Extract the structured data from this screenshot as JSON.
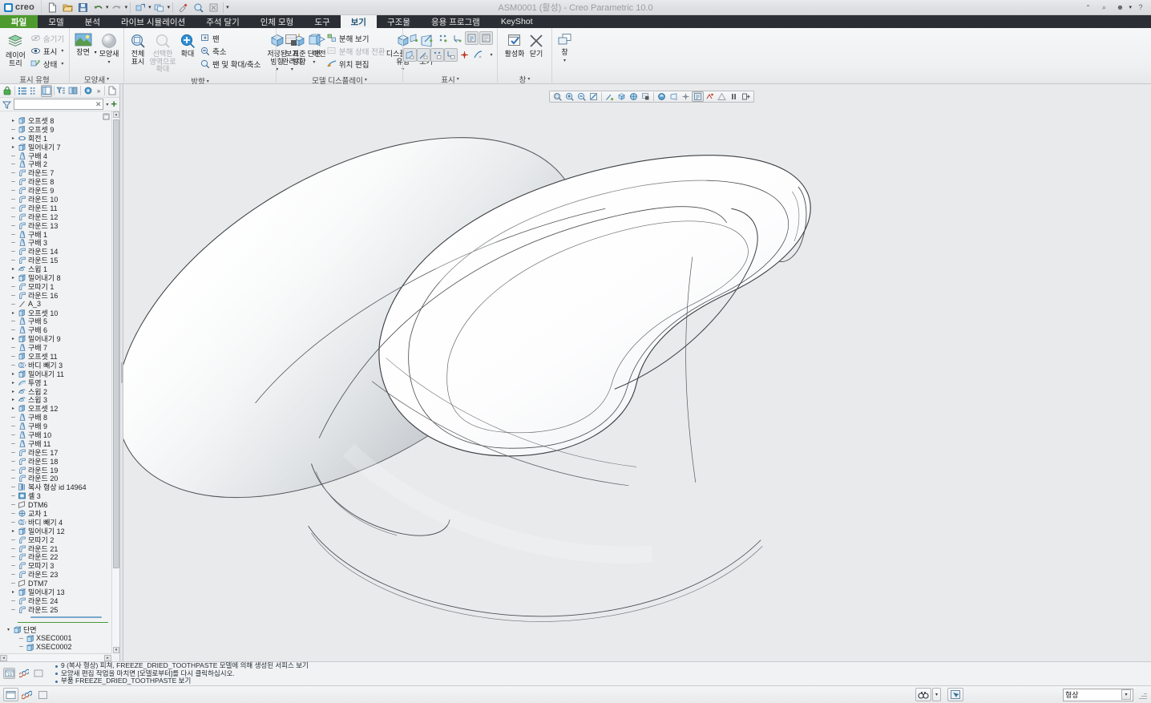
{
  "window": {
    "title": "ASM0001 (활성) - Creo Parametric 10.0",
    "brand": "creo",
    "controls": [
      {
        "name": "collapse-ribbon-button",
        "glyph": "⌃"
      },
      {
        "name": "search-button",
        "glyph": "⌕"
      },
      {
        "name": "account-button",
        "glyph": "☻"
      },
      {
        "name": "account-caret",
        "glyph": "▾"
      },
      {
        "name": "help-button",
        "glyph": "?"
      }
    ]
  },
  "quick_access": [
    {
      "name": "new-button",
      "icon": "new-file-icon"
    },
    {
      "name": "open-button",
      "icon": "open-folder-icon"
    },
    {
      "name": "save-button",
      "icon": "save-disk-icon"
    },
    {
      "name": "undo-button",
      "icon": "undo-arrow-icon"
    },
    {
      "name": "undo-caret",
      "icon": "chevron-down-icon"
    },
    {
      "name": "redo-button",
      "icon": "redo-arrow-icon"
    },
    {
      "name": "redo-caret",
      "icon": "chevron-down-icon"
    },
    {
      "name": "regenerate-button",
      "icon": "regenerate-icon"
    },
    {
      "name": "regenerate-caret",
      "icon": "chevron-down-icon"
    },
    {
      "name": "window-button",
      "icon": "window-switch-icon"
    },
    {
      "name": "window-caret",
      "icon": "chevron-down-icon"
    },
    {
      "name": "paint-button",
      "icon": "paintbrush-icon"
    },
    {
      "name": "magnifier-button",
      "icon": "magnifier-icon"
    },
    {
      "name": "close-window-button",
      "icon": "close-x-icon"
    },
    {
      "name": "qat-overflow",
      "icon": "chevron-down-icon"
    }
  ],
  "ribbon": {
    "tabs": [
      {
        "label": "파일",
        "kind": "file"
      },
      {
        "label": "모델",
        "kind": "normal"
      },
      {
        "label": "분석",
        "kind": "normal"
      },
      {
        "label": "라이브 시뮬레이션",
        "kind": "normal"
      },
      {
        "label": "주석 달기",
        "kind": "normal"
      },
      {
        "label": "인체 모형",
        "kind": "normal"
      },
      {
        "label": "도구",
        "kind": "normal"
      },
      {
        "label": "보기",
        "kind": "active"
      },
      {
        "label": "구조물",
        "kind": "normal"
      },
      {
        "label": "응용 프로그램",
        "kind": "normal"
      },
      {
        "label": "KeyShot",
        "kind": "normal"
      }
    ],
    "groups": [
      {
        "name": "visibility",
        "label": "표시 유형",
        "big": [
          {
            "label": "레이어 트리",
            "icon": "layers-icon"
          }
        ],
        "small": [
          {
            "label": "숨기기",
            "icon": "hide-eye-icon",
            "dim": true,
            "caret": false
          },
          {
            "label": "표시",
            "icon": "eye-icon",
            "dim": false,
            "caret": true
          },
          {
            "label": "상태",
            "icon": "state-icon",
            "dim": false,
            "caret": true
          }
        ]
      },
      {
        "name": "appearance",
        "label": "모양새",
        "caret": true,
        "big": [
          {
            "label": "장면",
            "icon": "scene-image-icon",
            "caret": true
          },
          {
            "label": "모양새",
            "icon": "appearance-sphere-icon",
            "caret": true
          }
        ]
      },
      {
        "name": "orientation",
        "label": "방향",
        "caret": true,
        "big": [
          {
            "label": "전체 표시",
            "icon": "zoom-fit-icon"
          },
          {
            "label": "선택한 영역으로 확대",
            "icon": "zoom-area-icon",
            "dim": true
          },
          {
            "label": "확대",
            "icon": "zoom-in-plus-icon"
          }
        ],
        "small": [
          {
            "label": "팬",
            "icon": "pan-icon"
          },
          {
            "label": "축소",
            "icon": "zoom-out-icon"
          },
          {
            "label": "팬 및 확대/축소",
            "icon": "pan-zoom-icon"
          }
        ],
        "big2": [
          {
            "label": "저장된 방향",
            "icon": "saved-orientation-icon",
            "caret": true
          },
          {
            "label": "표준 방향",
            "icon": "standard-orientation-icon"
          },
          {
            "label": "이전",
            "icon": "previous-view-icon"
          }
        ]
      },
      {
        "name": "model-display",
        "label": "모델 디스플레이",
        "caret": true,
        "big": [
          {
            "label": "보기 관리자",
            "icon": "view-manager-icon",
            "caret": true
          },
          {
            "label": "단면",
            "icon": "cross-section-icon",
            "caret": true
          }
        ],
        "small": [
          {
            "label": "분해 보기",
            "icon": "explode-view-icon"
          },
          {
            "label": "분해 상태 전환",
            "icon": "explode-toggle-icon",
            "dim": true
          },
          {
            "label": "위치 편집",
            "icon": "edit-position-icon"
          }
        ],
        "big2": [
          {
            "label": "디스플레이 유형",
            "icon": "display-style-cube-icon",
            "caret": true
          },
          {
            "label": "원근 보기",
            "icon": "perspective-view-icon"
          }
        ]
      },
      {
        "name": "display",
        "label": "표시",
        "caret": true,
        "toggles_top": [
          {
            "name": "datum-plane-toggle",
            "icon": "datum-plane-icon"
          },
          {
            "name": "datum-axis-toggle",
            "icon": "datum-axis-icon"
          },
          {
            "name": "datum-point-toggle",
            "icon": "datum-point-icon"
          },
          {
            "name": "datum-csys-toggle",
            "icon": "datum-csys-icon"
          },
          {
            "name": "annotation-toggle",
            "icon": "annotation-display-icon",
            "pressed": true
          },
          {
            "name": "annotation-tag-toggle",
            "icon": "annotation-tag-icon",
            "pressed": true
          }
        ],
        "toggles_bottom": [
          {
            "name": "plane-tag-toggle",
            "icon": "plane-tag-icon",
            "pressed": true
          },
          {
            "name": "axis-tag-toggle",
            "icon": "axis-tag-icon",
            "pressed": true
          },
          {
            "name": "point-tag-toggle",
            "icon": "point-tag-icon",
            "pressed": true
          },
          {
            "name": "csys-tag-toggle",
            "icon": "csys-tag-icon",
            "pressed": true
          },
          {
            "name": "spin-center-toggle",
            "icon": "spin-center-icon"
          },
          {
            "name": "curve-display-toggle",
            "icon": "curve-display-icon"
          },
          {
            "name": "display-overflow-caret",
            "icon": "chevron-down-icon"
          }
        ]
      },
      {
        "name": "window",
        "label": "창",
        "caret": true,
        "big": [
          {
            "label": "활성화",
            "icon": "activate-check-icon"
          },
          {
            "label": "닫기",
            "icon": "close-x-icon"
          }
        ],
        "big2": [
          {
            "label": "창",
            "icon": "windows-cascade-icon",
            "caret": true
          }
        ]
      }
    ]
  },
  "navigator": {
    "toolbar": [
      {
        "name": "model-tree-lock-button",
        "icon": "green-lock-icon"
      },
      {
        "name": "tree-list-button",
        "icon": "list-icon"
      },
      {
        "name": "tree-columns-button",
        "icon": "columns-icon"
      },
      {
        "name": "tree-layout-button",
        "icon": "layout-icon",
        "pressed": true
      },
      {
        "name": "tree-filter-button",
        "icon": "filter-sort-icon"
      },
      {
        "name": "tree-search-button",
        "icon": "tree-search-icon"
      },
      {
        "name": "tree-settings-button",
        "icon": "settings-blob-icon"
      },
      {
        "name": "tree-overflow-button",
        "icon": "double-chevron-icon"
      },
      {
        "name": "tree-document-button",
        "icon": "document-icon"
      }
    ],
    "filter": {
      "value": "",
      "placeholder": "",
      "clear_glyph": "✕",
      "caret_glyph": "▾",
      "add_glyph": "+"
    },
    "tree_items": [
      {
        "label": "오프셋 8",
        "icon": "offset-icon",
        "expandable": true,
        "indent": 0
      },
      {
        "label": "오프셋 9",
        "icon": "offset-icon",
        "expandable": false,
        "indent": 0
      },
      {
        "label": "회전 1",
        "icon": "revolve-icon",
        "expandable": true,
        "indent": 0
      },
      {
        "label": "밀어내기 7",
        "icon": "extrude-icon",
        "expandable": true,
        "indent": 0
      },
      {
        "label": "구배 4",
        "icon": "draft-icon",
        "expandable": false,
        "indent": 0
      },
      {
        "label": "구배 2",
        "icon": "draft-icon",
        "expandable": false,
        "indent": 0
      },
      {
        "label": "라운드 7",
        "icon": "round-icon",
        "expandable": false,
        "indent": 0
      },
      {
        "label": "라운드 8",
        "icon": "round-icon",
        "expandable": false,
        "indent": 0
      },
      {
        "label": "라운드 9",
        "icon": "round-icon",
        "expandable": false,
        "indent": 0
      },
      {
        "label": "라운드 10",
        "icon": "round-icon",
        "expandable": false,
        "indent": 0
      },
      {
        "label": "라운드 11",
        "icon": "round-icon",
        "expandable": false,
        "indent": 0
      },
      {
        "label": "라운드 12",
        "icon": "round-icon",
        "expandable": false,
        "indent": 0
      },
      {
        "label": "라운드 13",
        "icon": "round-icon",
        "expandable": false,
        "indent": 0
      },
      {
        "label": "구배 1",
        "icon": "draft-icon",
        "expandable": false,
        "indent": 0
      },
      {
        "label": "구배 3",
        "icon": "draft-icon",
        "expandable": false,
        "indent": 0
      },
      {
        "label": "라운드 14",
        "icon": "round-icon",
        "expandable": false,
        "indent": 0
      },
      {
        "label": "라운드 15",
        "icon": "round-icon",
        "expandable": false,
        "indent": 0
      },
      {
        "label": "스윕 1",
        "icon": "sweep-icon",
        "expandable": true,
        "indent": 0
      },
      {
        "label": "밀어내기 8",
        "icon": "extrude-icon",
        "expandable": true,
        "indent": 0
      },
      {
        "label": "모따기 1",
        "icon": "chamfer-icon",
        "expandable": false,
        "indent": 0
      },
      {
        "label": "라운드 16",
        "icon": "round-icon",
        "expandable": false,
        "indent": 0
      },
      {
        "label": "A_3",
        "icon": "axis-icon",
        "expandable": false,
        "indent": 0
      },
      {
        "label": "오프셋 10",
        "icon": "offset-icon",
        "expandable": true,
        "indent": 0
      },
      {
        "label": "구배 5",
        "icon": "draft-icon",
        "expandable": false,
        "indent": 0
      },
      {
        "label": "구배 6",
        "icon": "draft-icon",
        "expandable": false,
        "indent": 0
      },
      {
        "label": "밀어내기 9",
        "icon": "extrude-icon",
        "expandable": true,
        "indent": 0
      },
      {
        "label": "구배 7",
        "icon": "draft-icon",
        "expandable": false,
        "indent": 0
      },
      {
        "label": "오프셋 11",
        "icon": "offset-icon",
        "expandable": false,
        "indent": 0
      },
      {
        "label": "바디 빼기 3",
        "icon": "body-subtract-icon",
        "expandable": false,
        "indent": 0
      },
      {
        "label": "밀어내기 11",
        "icon": "extrude-icon",
        "expandable": true,
        "indent": 0
      },
      {
        "label": "투영 1",
        "icon": "project-icon",
        "expandable": true,
        "indent": 0
      },
      {
        "label": "스윕 2",
        "icon": "sweep-icon",
        "expandable": true,
        "indent": 0
      },
      {
        "label": "스윕 3",
        "icon": "sweep-icon",
        "expandable": true,
        "indent": 0
      },
      {
        "label": "오프셋 12",
        "icon": "offset-icon",
        "expandable": true,
        "indent": 0
      },
      {
        "label": "구배 8",
        "icon": "draft-icon",
        "expandable": false,
        "indent": 0
      },
      {
        "label": "구배 9",
        "icon": "draft-icon",
        "expandable": false,
        "indent": 0
      },
      {
        "label": "구배 10",
        "icon": "draft-icon",
        "expandable": false,
        "indent": 0
      },
      {
        "label": "구배 11",
        "icon": "draft-icon",
        "expandable": false,
        "indent": 0
      },
      {
        "label": "라운드 17",
        "icon": "round-icon",
        "expandable": false,
        "indent": 0
      },
      {
        "label": "라운드 18",
        "icon": "round-icon",
        "expandable": false,
        "indent": 0
      },
      {
        "label": "라운드 19",
        "icon": "round-icon",
        "expandable": false,
        "indent": 0
      },
      {
        "label": "라운드 20",
        "icon": "round-icon",
        "expandable": false,
        "indent": 0
      },
      {
        "label": "복사 형상 id 14964",
        "icon": "copy-geom-icon",
        "expandable": false,
        "indent": 0
      },
      {
        "label": "셸 3",
        "icon": "shell-icon",
        "expandable": false,
        "indent": 0
      },
      {
        "label": "DTM6",
        "icon": "datum-plane-icon",
        "expandable": false,
        "indent": 0
      },
      {
        "label": "교차 1",
        "icon": "intersect-icon",
        "expandable": false,
        "indent": 0
      },
      {
        "label": "바디 빼기 4",
        "icon": "body-subtract-icon",
        "expandable": false,
        "indent": 0
      },
      {
        "label": "밀어내기 12",
        "icon": "extrude-icon",
        "expandable": true,
        "indent": 0
      },
      {
        "label": "모따기 2",
        "icon": "chamfer-icon",
        "expandable": false,
        "indent": 0
      },
      {
        "label": "라운드 21",
        "icon": "round-icon",
        "expandable": false,
        "indent": 0
      },
      {
        "label": "라운드 22",
        "icon": "round-icon",
        "expandable": false,
        "indent": 0
      },
      {
        "label": "모따기 3",
        "icon": "chamfer-icon",
        "expandable": false,
        "indent": 0
      },
      {
        "label": "라운드 23",
        "icon": "round-icon",
        "expandable": false,
        "indent": 0
      },
      {
        "label": "DTM7",
        "icon": "datum-plane-icon",
        "expandable": false,
        "indent": 0
      },
      {
        "label": "밀어내기 13",
        "icon": "extrude-icon",
        "expandable": true,
        "indent": 0
      },
      {
        "label": "라운드 24",
        "icon": "round-icon",
        "expandable": false,
        "indent": 0
      },
      {
        "label": "라운드 25",
        "icon": "round-icon",
        "expandable": false,
        "indent": 0
      }
    ],
    "section_group": {
      "label": "단면",
      "icon": "section-folder-icon",
      "expanded_glyph": "▾",
      "children": [
        {
          "label": "XSEC0001",
          "icon": "xsec-icon"
        },
        {
          "label": "XSEC0002",
          "icon": "xsec-icon"
        }
      ]
    }
  },
  "graphics_toolbar": [
    {
      "name": "refit-button",
      "icon": "zoom-fit-icon"
    },
    {
      "name": "zoom-in-button",
      "icon": "zoom-in-icon"
    },
    {
      "name": "zoom-out-button",
      "icon": "zoom-out-icon"
    },
    {
      "name": "repaint-button",
      "icon": "repaint-icon"
    },
    {
      "name": "datum-display-button",
      "icon": "datum-display-icon"
    },
    {
      "name": "display-style-button",
      "icon": "display-style-cube-icon"
    },
    {
      "name": "saved-orientation-button",
      "icon": "saved-orientation-icon"
    },
    {
      "name": "view-manager-button",
      "icon": "view-manager-icon"
    },
    {
      "name": "appearance-gallery-button",
      "icon": "appearance-sphere-icon"
    },
    {
      "name": "perspective-button",
      "icon": "perspective-view-icon"
    },
    {
      "name": "spin-center-button",
      "icon": "spin-center-icon"
    },
    {
      "name": "annotation-display-button",
      "icon": "annotation-display-icon",
      "pressed": true
    },
    {
      "name": "section-button",
      "icon": "cross-section-icon"
    },
    {
      "name": "warning-button",
      "icon": "warning-triangle-icon"
    },
    {
      "name": "pause-button",
      "icon": "pause-icon"
    },
    {
      "name": "exit-button",
      "icon": "exit-icon"
    }
  ],
  "messages": {
    "icons": [
      {
        "name": "message-log-button",
        "icon": "message-log-icon",
        "pressed": true
      },
      {
        "name": "link-button",
        "icon": "link-icon"
      },
      {
        "name": "panel-button",
        "icon": "panel-icon"
      }
    ],
    "lines": [
      "9 (복사 형상) 피쳐, FREEZE_DRIED_TOOTHPASTE 모델에 의해 생성된 서피스 보기",
      "모양새 편집 작업을 마치면 [모델로부터]를 다시 클릭하십시오.",
      "부품 FREEZE_DRIED_TOOTHPASTE 보기"
    ]
  },
  "status_bar": {
    "search_button": {
      "name": "find-button",
      "icon": "binoculars-icon"
    },
    "search_caret": "▾",
    "selection_button": {
      "name": "selection-filter-button",
      "icon": "select-box-icon"
    },
    "filter_select": {
      "value": "형상",
      "caret": "▾"
    }
  }
}
